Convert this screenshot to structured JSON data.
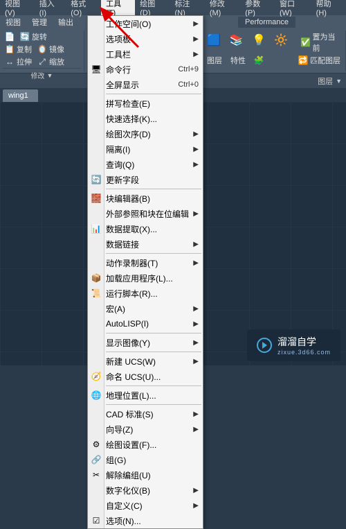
{
  "menubar": {
    "items": [
      {
        "label": "视图(V)"
      },
      {
        "label": "插入(I)"
      },
      {
        "label": "格式(O)"
      },
      {
        "label": "工具(T)"
      },
      {
        "label": "绘图(D)"
      },
      {
        "label": "标注(N)"
      },
      {
        "label": "修改(M)"
      },
      {
        "label": "参数(P)"
      },
      {
        "label": "窗口(W)"
      },
      {
        "label": "帮助(H)"
      }
    ]
  },
  "subbar": {
    "items": [
      {
        "label": "视图"
      },
      {
        "label": "管理"
      },
      {
        "label": "输出"
      }
    ],
    "perf_label": "Performance"
  },
  "ribbon": {
    "g1": {
      "row1": [
        {
          "icon": "📄",
          "label": ""
        },
        {
          "icon": "🔄",
          "label": "旋转"
        }
      ],
      "row2": [
        {
          "icon": "📋",
          "label": "复制"
        },
        {
          "icon": "🪞",
          "label": "镜像"
        }
      ],
      "row3": [
        {
          "icon": "↔",
          "label": "拉伸"
        },
        {
          "icon": "⤢",
          "label": "缩放"
        }
      ],
      "group_label": "修改"
    },
    "g2": {
      "big": [
        {
          "icon": "🟦"
        },
        {
          "icon": "📚"
        },
        {
          "icon": "💡"
        },
        {
          "icon": "🔆"
        }
      ],
      "row": [
        {
          "label": "图层",
          "icon": "📐"
        },
        {
          "label": "特性",
          "icon": "📋"
        },
        {
          "label": "",
          "icon": "🧩"
        }
      ],
      "extra": [
        {
          "label": "置为当前",
          "icon": "✅"
        },
        {
          "label": "匹配图层",
          "icon": "🔁"
        }
      ]
    }
  },
  "layerbar": {
    "label": "图层"
  },
  "tab": {
    "label": "wing1"
  },
  "dropdown": {
    "groups": [
      [
        {
          "label": "工作空间(O)",
          "icon": "",
          "arrow": true
        },
        {
          "label": "选项板",
          "icon": "",
          "arrow": true
        },
        {
          "label": "工具栏",
          "icon": "",
          "arrow": true
        },
        {
          "label": "命令行",
          "icon": "🖥",
          "shortcut": "Ctrl+9"
        },
        {
          "label": "全屏显示",
          "icon": "",
          "shortcut": "Ctrl+0"
        }
      ],
      [
        {
          "label": "拼写检查(E)",
          "icon": ""
        },
        {
          "label": "快速选择(K)...",
          "icon": ""
        },
        {
          "label": "绘图次序(D)",
          "icon": "",
          "arrow": true
        },
        {
          "label": "隔离(I)",
          "icon": "",
          "arrow": true
        },
        {
          "label": "查询(Q)",
          "icon": "",
          "arrow": true
        },
        {
          "label": "更新字段",
          "icon": "🔄"
        }
      ],
      [
        {
          "label": "块编辑器(B)",
          "icon": "🧱"
        },
        {
          "label": "外部参照和块在位编辑",
          "icon": "",
          "arrow": true
        },
        {
          "label": "数据提取(X)...",
          "icon": "📊"
        },
        {
          "label": "数据链接",
          "icon": "",
          "arrow": true
        }
      ],
      [
        {
          "label": "动作录制器(T)",
          "icon": "",
          "arrow": true
        },
        {
          "label": "加载应用程序(L)...",
          "icon": "📦"
        },
        {
          "label": "运行脚本(R)...",
          "icon": "📜"
        },
        {
          "label": "宏(A)",
          "icon": "",
          "arrow": true
        },
        {
          "label": "AutoLISP(I)",
          "icon": "",
          "arrow": true
        }
      ],
      [
        {
          "label": "显示图像(Y)",
          "icon": "",
          "arrow": true
        }
      ],
      [
        {
          "label": "新建 UCS(W)",
          "icon": "",
          "arrow": true
        },
        {
          "label": "命名 UCS(U)...",
          "icon": "🧭"
        }
      ],
      [
        {
          "label": "地理位置(L)...",
          "icon": "🌐"
        }
      ],
      [
        {
          "label": "CAD 标准(S)",
          "icon": "",
          "arrow": true
        },
        {
          "label": "向导(Z)",
          "icon": "",
          "arrow": true
        },
        {
          "label": "绘图设置(F)...",
          "icon": "⚙"
        },
        {
          "label": "组(G)",
          "icon": "🔗"
        },
        {
          "label": "解除编组(U)",
          "icon": "✂"
        },
        {
          "label": "数字化仪(B)",
          "icon": "",
          "arrow": true
        },
        {
          "label": "自定义(C)",
          "icon": "",
          "arrow": true
        },
        {
          "label": "选项(N)...",
          "icon": "☑"
        }
      ]
    ]
  },
  "watermark": {
    "brand": "溜溜自学",
    "url": "zixue.3d66.com"
  }
}
